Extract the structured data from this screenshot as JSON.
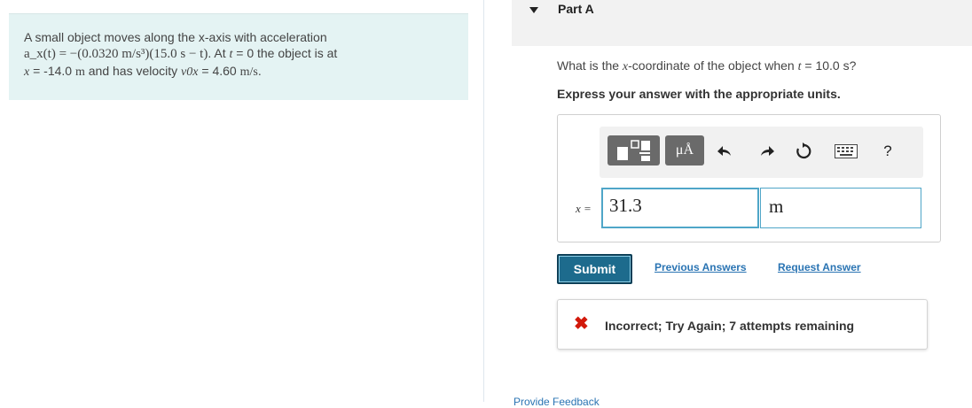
{
  "problem": {
    "line1": "A small object moves along the x-axis with acceleration",
    "line2_formula": "a_x(t) = −(0.0320 m/s³)(15.0 s − t)",
    "line2_middle": ". At ",
    "t_symbol": "t",
    "line2_tail": " = 0 the object is at",
    "x_symbol": "x",
    "line3_a": " = -14.0 ",
    "unit_m": "m",
    "line3_b": " and has velocity ",
    "v0_symbol": "v0x",
    "line3_c": " = 4.60 ",
    "unit_ms": "m/s",
    "line3_end": "."
  },
  "part": {
    "title": "Part A"
  },
  "question": {
    "prefix": "What is the ",
    "x_symbol": "x",
    "middle": "-coordinate of the object when ",
    "t_symbol": "t",
    "suffix": " = 10.0 s?"
  },
  "instruction": "Express your answer with the appropriate units.",
  "answer": {
    "label": "x =",
    "value": "31.3",
    "unit": "m"
  },
  "toolbar": {
    "units_label": "μÅ",
    "undo": "undo-icon",
    "redo": "redo-icon",
    "reset": "reset-icon",
    "keyboard": "keyboard-icon",
    "help": "?"
  },
  "actions": {
    "submit_label": "Submit",
    "previous_answers_label": "Previous Answers",
    "request_answer_label": "Request Answer"
  },
  "feedback": {
    "icon": "x-icon",
    "text": "Incorrect; Try Again; 7 attempts remaining",
    "color": "#d2190b"
  },
  "bottom": {
    "link_text": "Provide Feedback"
  },
  "colors": {
    "problem_bg": "#e4f3f3",
    "header_bg": "#f2f2f2",
    "submit_bg": "#1d6b8d",
    "link": "#2a74b3",
    "input_border": "#4fa6c8"
  }
}
